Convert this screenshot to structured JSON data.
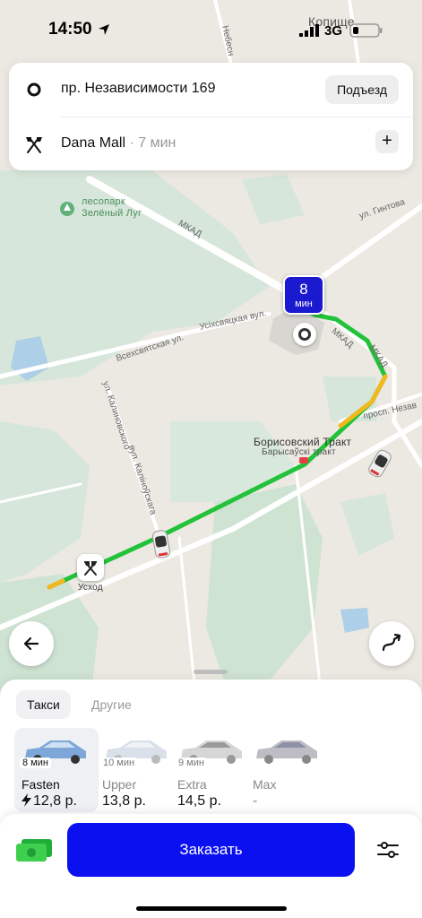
{
  "status_bar": {
    "time": "14:50",
    "network": "3G",
    "icons": [
      "location-arrow-icon",
      "signal-icon",
      "battery-icon"
    ]
  },
  "addresses": {
    "from": {
      "text": "пр. Независимости 169",
      "button": "Подъезд",
      "icon": "pickup-circle-icon"
    },
    "to": {
      "text": "Dana Mall",
      "eta": " · 7 мин",
      "icon": "flags-icon",
      "add": "+"
    }
  },
  "map": {
    "labels": {
      "park": "лесопарк\nЗелёный Луг",
      "mkad_top": "МКАД",
      "gintova": "ул. Гинтова",
      "nebesnaya": "Небесн",
      "kopishche": "Копище",
      "vseh_svyatskaya": "Всехсвятская ул.",
      "usikh_svyatskaya": "Усіхсвяцкая вул.",
      "mkad_right_1": "МКАД",
      "mkad_right_2": "МКАД",
      "kalinovskogo": "ул. Калиновского",
      "kalinovskaga": "вул. Каліноўскага",
      "borisovsky": "Борисовский Тракт",
      "barysauski": "Барысаўскі тракт",
      "prosp_nez": "просп. Незав",
      "uskhod": "Усход"
    },
    "eta_badge": {
      "value": "8",
      "unit": "мин"
    },
    "colors": {
      "route_green": "#22c23a",
      "route_yellow": "#f2b820",
      "water": "#aecfe8",
      "park": "#cde3d3"
    }
  },
  "sheet": {
    "tabs": [
      {
        "label": "Такси",
        "active": true
      },
      {
        "label": "Другие",
        "active": false
      }
    ],
    "tariffs": [
      {
        "time": "8 мин",
        "name": "Fasten",
        "price": "12,8 р.",
        "selected": true,
        "bolt": true
      },
      {
        "time": "10 мин",
        "name": "Upper",
        "price": "13,8 р.",
        "selected": false
      },
      {
        "time": "9 мин",
        "name": "Extra",
        "price": "14,5 р.",
        "selected": false
      },
      {
        "time": "",
        "name": "Max",
        "price": "-",
        "selected": false
      }
    ],
    "order_button": "Заказать",
    "accent": "#0a10f0"
  }
}
